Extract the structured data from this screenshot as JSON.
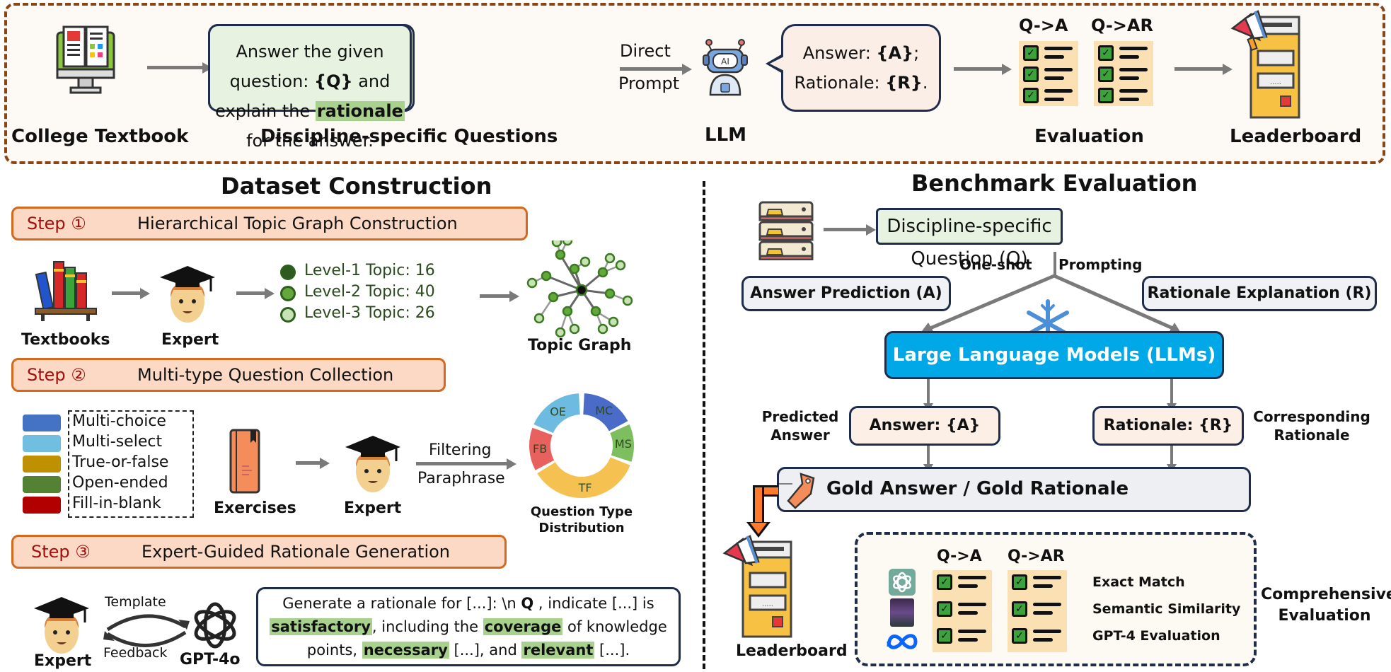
{
  "pipeline": {
    "textbook_label": "College Textbook",
    "prompt_line1_pre": "Answer the given question: ",
    "prompt_q": "{Q}",
    "prompt_line1_post": " and",
    "prompt_line2_pre": "explain the ",
    "prompt_highlight": "rationale",
    "prompt_line2_post": " for the answer.",
    "questions_label": "Discipline-specific Questions",
    "direct_label": "Direct",
    "prompt_label": "Prompt",
    "llm_label": "LLM",
    "bubble_line1_pre": "Answer: ",
    "bubble_a": "{A}",
    "bubble_line1_post": ";",
    "bubble_line2_pre": "Rationale: ",
    "bubble_r": "{R}",
    "bubble_line2_post": ".",
    "eval_col1": "Q->A",
    "eval_col2": "Q->AR",
    "evaluation_label": "Evaluation",
    "leaderboard_label": "Leaderboard"
  },
  "dataset": {
    "title": "Dataset Construction",
    "step1": {
      "number": "Step ①",
      "text": "Hierarchical Topic Graph Construction"
    },
    "textbooks_label": "Textbooks",
    "expert_label": "Expert",
    "levels": [
      {
        "label": "Level-1 Topic:  16",
        "color": "#2f5a1f"
      },
      {
        "label": "Level-2 Topic: 40",
        "color": "#62a83a"
      },
      {
        "label": "Level-3 Topic: 26",
        "color": "#c7e2b3"
      }
    ],
    "topic_graph_label": "Topic Graph",
    "step2": {
      "number": "Step ②",
      "text": "Multi-type Question Collection"
    },
    "legend": [
      {
        "label": "Multi-choice",
        "color": "#4472c4"
      },
      {
        "label": "Multi-select",
        "color": "#70bfe0"
      },
      {
        "label": "True-or-false",
        "color": "#bf9000"
      },
      {
        "label": "Open-ended",
        "color": "#548235"
      },
      {
        "label": "Fill-in-blank",
        "color": "#b00000"
      }
    ],
    "exercises_label": "Exercises",
    "expert2_label": "Expert",
    "filtering_label": "Filtering",
    "paraphrase_label": "Paraphrase",
    "donut": {
      "segments": [
        {
          "label": "MC",
          "color": "#4a6cc8"
        },
        {
          "label": "MS",
          "color": "#7dbf5e"
        },
        {
          "label": "TF",
          "color": "#f5c252"
        },
        {
          "label": "FB",
          "color": "#e8615f"
        },
        {
          "label": "OE",
          "color": "#6dbbe0"
        }
      ],
      "caption_line1": "Question Type",
      "caption_line2": "Distribution"
    },
    "step3": {
      "number": "Step ③",
      "text": "Expert-Guided Rationale Generation"
    },
    "expert3_label": "Expert",
    "template_label": "Template",
    "feedback_label": "Feedback",
    "gpt_label": "GPT-4o",
    "rationale_prompt": {
      "l1_pre": "Generate a rationale for [...]: \\n ",
      "l1_q": "Q",
      "l1_post": " , indicate [...] is",
      "h1": "satisfactory",
      "l2_mid": ", including the ",
      "h2": "coverage",
      "l2_post": " of knowledge",
      "l3_pre": "points, ",
      "h3": "necessary",
      "l3_mid": " [...], and ",
      "h4": "relevant",
      "l3_post": " [...]."
    }
  },
  "benchmark": {
    "title": "Benchmark Evaluation",
    "question_box": "Discipline-specific Question (Q)",
    "one_shot": "One-shot",
    "prompting": "Prompting",
    "answer_prediction": "Answer Prediction (A)",
    "rationale_explanation": "Rationale Explanation (R)",
    "llms": "Large Language Models (LLMs)",
    "predicted_answer_l1": "Predicted",
    "predicted_answer_l2": "Answer",
    "answer_box": "Answer: {A}",
    "rationale_box": "Rationale: {R}",
    "corresponding_l1": "Corresponding",
    "corresponding_l2": "Rationale",
    "gold_box": "Gold Answer / Gold Rationale",
    "leaderboard_label": "Leaderboard",
    "eval_col1": "Q->A",
    "eval_col2": "Q->AR",
    "metrics": [
      "Exact Match",
      "Semantic Similarity",
      "GPT-4 Evaluation"
    ],
    "comprehensive_l1": "Comprehensive",
    "comprehensive_l2": "Evaluation"
  }
}
